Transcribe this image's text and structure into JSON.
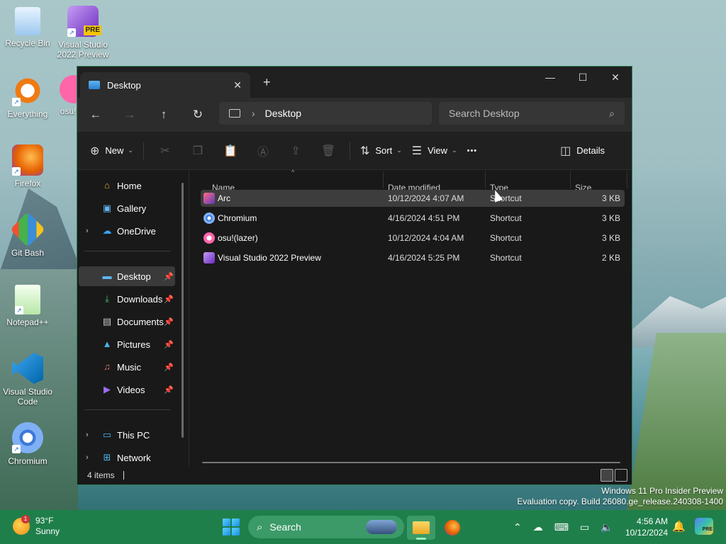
{
  "desktop": {
    "icons": [
      {
        "label": "Recycle Bin"
      },
      {
        "label": "Visual Studio 2022 Preview",
        "badge": "PRE"
      },
      {
        "label": "Everything"
      },
      {
        "label": "osu!"
      },
      {
        "label": "Firefox"
      },
      {
        "label": "Git Bash"
      },
      {
        "label": "Notepad++"
      },
      {
        "label": "Visual Studio Code"
      },
      {
        "label": "Chromium"
      }
    ],
    "watermark": {
      "line1": "Windows 11 Pro Insider Preview",
      "line2": "Evaluation copy. Build 26080.ge_release.240308-1400"
    }
  },
  "explorer": {
    "tab": {
      "label": "Desktop"
    },
    "address": {
      "segment": "Desktop"
    },
    "search": {
      "placeholder": "Search Desktop"
    },
    "toolbar": {
      "new_label": "New",
      "sort_label": "Sort",
      "view_label": "View",
      "more_label": "•••",
      "details_label": "Details"
    },
    "sidebar": {
      "items": [
        {
          "label": "Home"
        },
        {
          "label": "Gallery"
        },
        {
          "label": "OneDrive"
        },
        {
          "label": "Desktop"
        },
        {
          "label": "Downloads"
        },
        {
          "label": "Documents"
        },
        {
          "label": "Pictures"
        },
        {
          "label": "Music"
        },
        {
          "label": "Videos"
        },
        {
          "label": "This PC"
        },
        {
          "label": "Network"
        }
      ]
    },
    "columns": {
      "name": "Name",
      "date": "Date modified",
      "type": "Type",
      "size": "Size"
    },
    "files": [
      {
        "name": "Arc",
        "date": "10/12/2024 4:07 AM",
        "type": "Shortcut",
        "size": "3 KB"
      },
      {
        "name": "Chromium",
        "date": "4/16/2024 4:51 PM",
        "type": "Shortcut",
        "size": "3 KB"
      },
      {
        "name": "osu!(lazer)",
        "date": "10/12/2024 4:04 AM",
        "type": "Shortcut",
        "size": "3 KB"
      },
      {
        "name": "Visual Studio 2022 Preview",
        "date": "4/16/2024 5:25 PM",
        "type": "Shortcut",
        "size": "2 KB"
      }
    ],
    "status": {
      "count": "4 items"
    }
  },
  "taskbar": {
    "weather": {
      "temp": "93°F",
      "condition": "Sunny",
      "badge": "1"
    },
    "search_label": "Search",
    "clock": {
      "time": "4:56 AM",
      "date": "10/12/2024"
    },
    "copilot_badge": "PRE"
  },
  "colors": {
    "taskbar": "#1f7f4b",
    "window_bg": "#191919",
    "accent_border": "#2f7d58"
  }
}
